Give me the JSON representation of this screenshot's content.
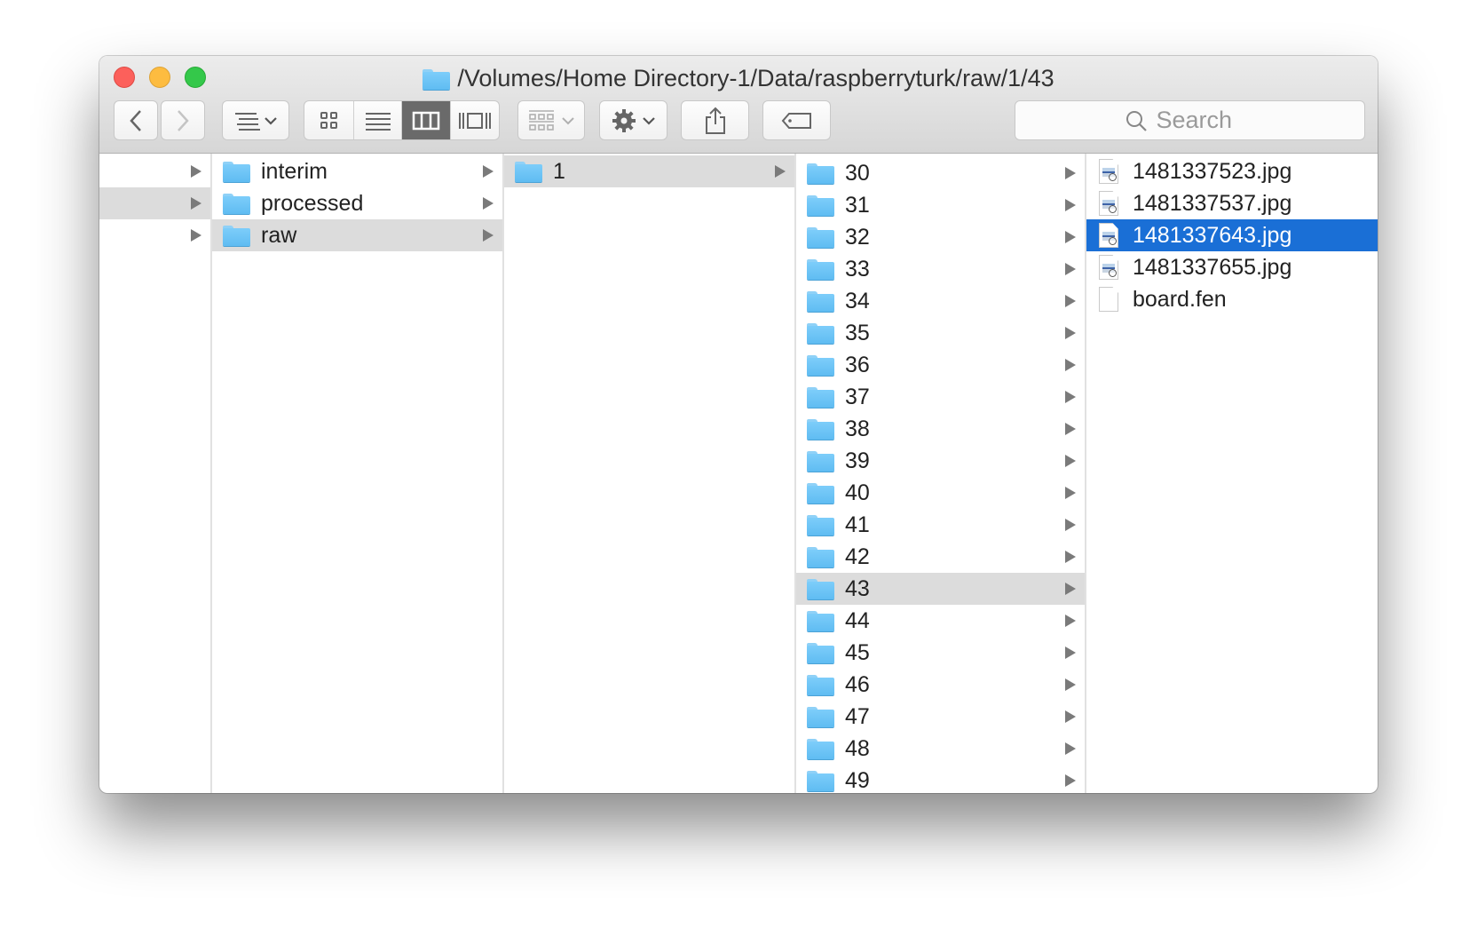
{
  "window": {
    "title": "/Volumes/Home Directory-1/Data/raspberryturk/raw/1/43",
    "title_icon": "folder-icon"
  },
  "toolbar": {
    "back_icon": "chevron-left-icon",
    "forward_icon": "chevron-right-icon",
    "arrange_icon": "list-arrange-icon",
    "view_modes": [
      {
        "name": "icon-view",
        "icon": "grid-icon",
        "active": false
      },
      {
        "name": "list-view",
        "icon": "list-icon",
        "active": false
      },
      {
        "name": "column-view",
        "icon": "columns-icon",
        "active": true
      },
      {
        "name": "cover-flow-view",
        "icon": "cover-flow-icon",
        "active": false
      }
    ],
    "group_icon": "group-icon",
    "action_icon": "gear-icon",
    "share_icon": "share-icon",
    "tag_icon": "tag-icon",
    "search_placeholder": "Search"
  },
  "columns": [
    {
      "items": [
        {
          "name": "",
          "has_children": true,
          "selected": false
        },
        {
          "name": "",
          "has_children": true,
          "selected": true
        },
        {
          "name": "",
          "has_children": true,
          "selected": false
        }
      ]
    },
    {
      "items": [
        {
          "name": "interim",
          "type": "folder",
          "has_children": true
        },
        {
          "name": "processed",
          "type": "folder",
          "has_children": true
        },
        {
          "name": "raw",
          "type": "folder",
          "has_children": true,
          "selected": true
        }
      ]
    },
    {
      "items": [
        {
          "name": "1",
          "type": "folder",
          "has_children": true,
          "selected": true
        }
      ]
    },
    {
      "items": [
        {
          "name": "30",
          "type": "folder"
        },
        {
          "name": "31",
          "type": "folder"
        },
        {
          "name": "32",
          "type": "folder"
        },
        {
          "name": "33",
          "type": "folder"
        },
        {
          "name": "34",
          "type": "folder"
        },
        {
          "name": "35",
          "type": "folder"
        },
        {
          "name": "36",
          "type": "folder"
        },
        {
          "name": "37",
          "type": "folder"
        },
        {
          "name": "38",
          "type": "folder"
        },
        {
          "name": "39",
          "type": "folder"
        },
        {
          "name": "40",
          "type": "folder"
        },
        {
          "name": "41",
          "type": "folder"
        },
        {
          "name": "42",
          "type": "folder"
        },
        {
          "name": "43",
          "type": "folder",
          "selected": true
        },
        {
          "name": "44",
          "type": "folder"
        },
        {
          "name": "45",
          "type": "folder"
        },
        {
          "name": "46",
          "type": "folder"
        },
        {
          "name": "47",
          "type": "folder"
        },
        {
          "name": "48",
          "type": "folder"
        },
        {
          "name": "49",
          "type": "folder"
        }
      ]
    },
    {
      "items": [
        {
          "name": "1481337523.jpg",
          "type": "image"
        },
        {
          "name": "1481337537.jpg",
          "type": "image"
        },
        {
          "name": "1481337643.jpg",
          "type": "image",
          "selected": true
        },
        {
          "name": "1481337655.jpg",
          "type": "image"
        },
        {
          "name": "board.fen",
          "type": "document"
        }
      ]
    }
  ],
  "colors": {
    "selection_active": "#1a6fd6",
    "selection_inactive": "#dcdcdc",
    "folder": "#6cc4f6",
    "close": "#fc605b",
    "minimize": "#fdbc40",
    "maximize": "#34c84a"
  }
}
